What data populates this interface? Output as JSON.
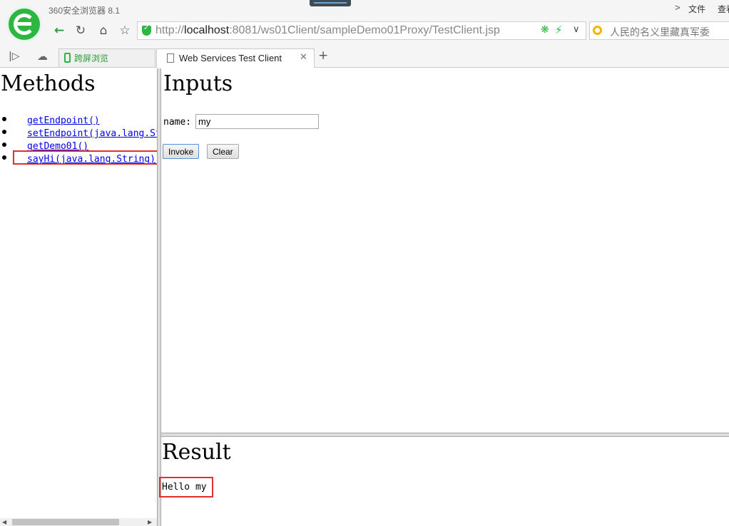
{
  "browser": {
    "app_title": "360安全浏览器 8.1",
    "menu": {
      "chevron": ">",
      "file": "文件",
      "view": "查看"
    },
    "url": {
      "prefix": "http://",
      "host": "localhost",
      "rest": ":8081/ws01Client/sampleDemo01Proxy/TestClient.jsp"
    },
    "search_text": "人民的名义里藏真军委",
    "tabs": [
      {
        "label": "跨屏浏览"
      },
      {
        "label": "Web Services Test Client"
      }
    ],
    "icons": {
      "back": "back-arrow-icon",
      "refresh": "refresh-icon",
      "home": "home-icon",
      "star": "star-icon",
      "shield": "shield-icon",
      "gear": "gear-icon",
      "bolt": "bolt-icon",
      "cloud": "cloud-icon",
      "phone": "phone-icon"
    },
    "accent_color": "#2db742"
  },
  "methods": {
    "title": "Methods",
    "items": [
      "getEndpoint()",
      "setEndpoint(java.lang.String)",
      "getDemo01()",
      "sayHi(java.lang.String)"
    ]
  },
  "inputs": {
    "title": "Inputs",
    "name_label": "name:",
    "name_value": "my",
    "invoke_label": "Invoke",
    "clear_label": "Clear"
  },
  "result": {
    "title": "Result",
    "text": "Hello my"
  },
  "highlight_color": "#e03030"
}
